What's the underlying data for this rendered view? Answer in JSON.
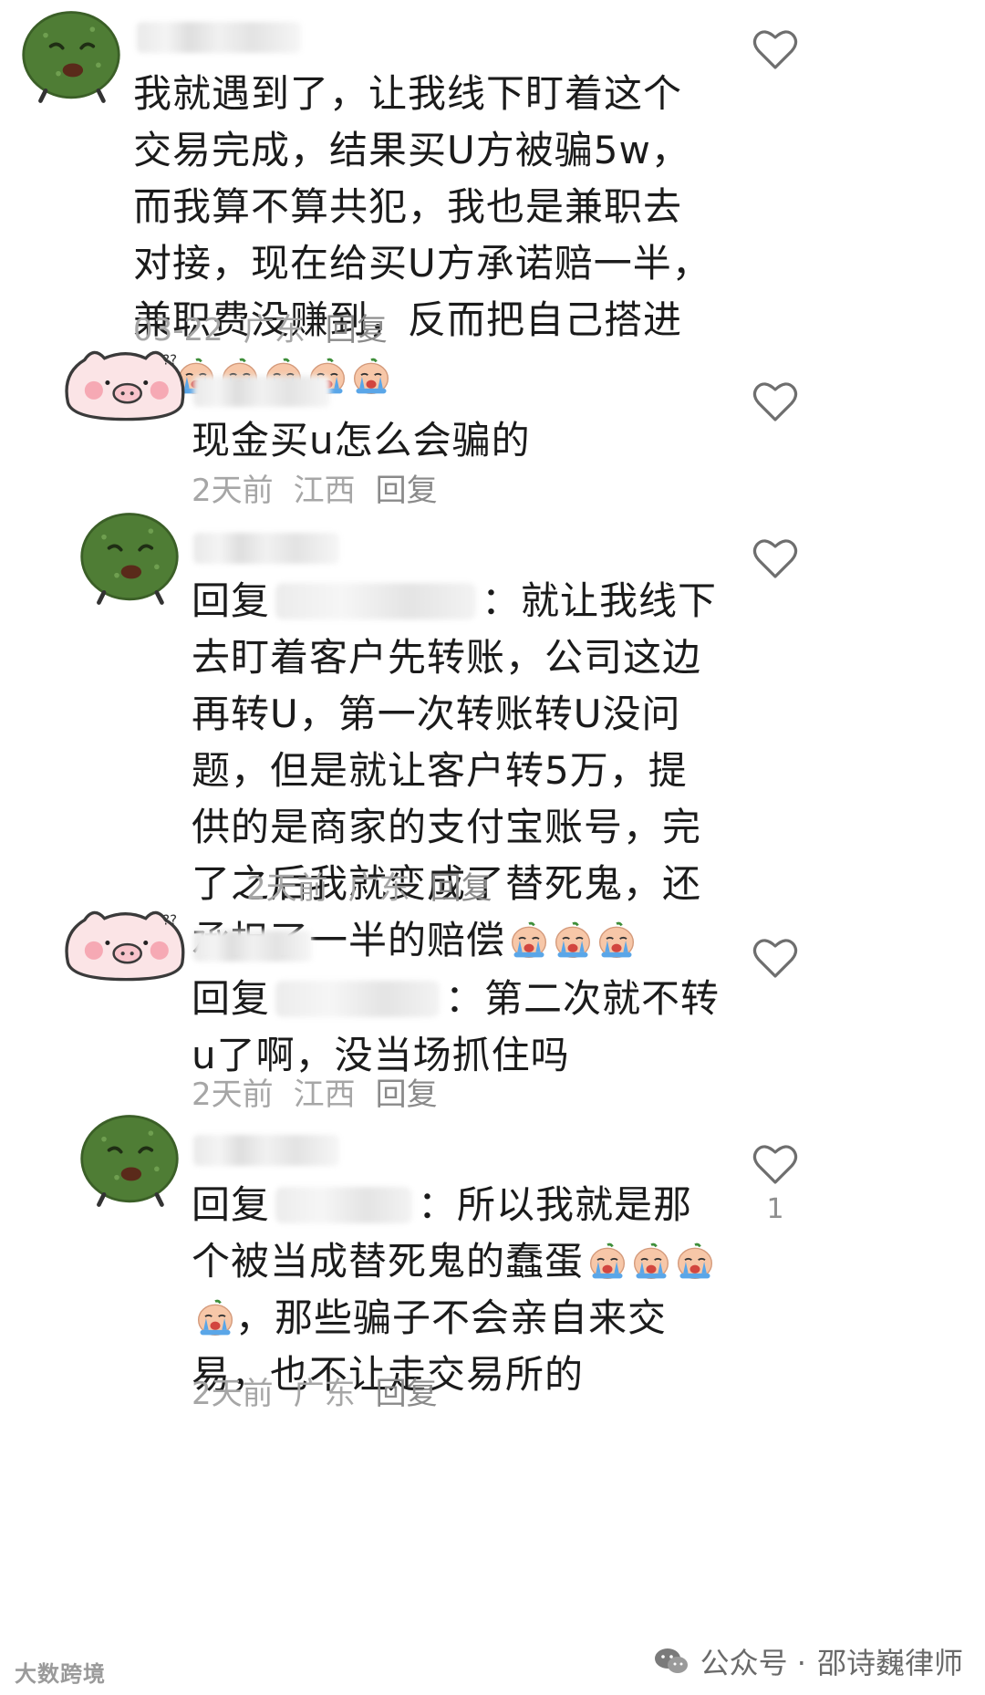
{
  "comments": [
    {
      "avatar": "green-blob-avatar",
      "text": "我就遇到了，让我线下盯着这个交易完成，结果买U方被骗5w，而我算不算共犯，我也是兼职去对接，现在给买U方承诺赔一半，兼职费没赚到，反而把自己搭进去",
      "emoji_count": 5,
      "date": "03-22",
      "location": "广东",
      "reply": "回复"
    },
    {
      "avatar": "pink-pig-avatar",
      "text": "现金买u怎么会骗的",
      "date": "2天前",
      "location": "江西",
      "reply": "回复"
    },
    {
      "avatar": "green-blob-avatar",
      "reply_prefix": "回复",
      "text": "：就让我线下去盯着客户先转账，公司这边再转U，第一次转账转U没问题，但是就让客户转5万，提供的是商家的支付宝账号，完了之后我就变成了替死鬼，还承担了一半的赔偿",
      "emoji_count": 3,
      "date": "2天前",
      "location": "广东",
      "reply": "回复"
    },
    {
      "avatar": "pink-pig-avatar",
      "reply_prefix": "回复",
      "text": "：第二次就不转u了啊，没当场抓住吗",
      "date": "2天前",
      "location": "江西",
      "reply": "回复"
    },
    {
      "avatar": "green-blob-avatar",
      "reply_prefix": "回复",
      "text_a": "：所以我就是那个被当成替死鬼的蠢蛋",
      "text_b": "，那些骗子不会亲自来交易，也不让走交易所的",
      "date": "2天前",
      "location": "广东",
      "reply": "回复",
      "likes": "1"
    }
  ],
  "watermark": {
    "right_prefix": "公众号 · ",
    "right_name": "邵诗巍律师",
    "left": "大数跨境"
  },
  "colors": {
    "text": "#1b1b1b",
    "meta": "#a6a6a6",
    "heart": "#6e6e6e"
  }
}
